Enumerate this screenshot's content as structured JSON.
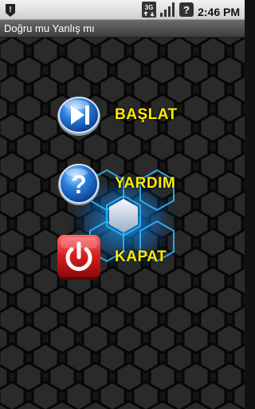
{
  "status_bar": {
    "network_type": "3G",
    "time": "2:46 PM",
    "icons": [
      "notification-icon",
      "network-3g-icon",
      "signal-icon",
      "battery-icon"
    ]
  },
  "app": {
    "title": "Doğru mu Yanlış mı"
  },
  "menu": {
    "items": [
      {
        "label": "BAŞLAT",
        "icon": "play-skip-icon"
      },
      {
        "label": "YARDIM",
        "icon": "help-icon"
      },
      {
        "label": "KAPAT",
        "icon": "power-icon"
      }
    ]
  },
  "colors": {
    "label_yellow": "#ffeb00",
    "glow_blue": "#19a8ff",
    "button_blue": "#2b7fe0",
    "button_red": "#d81c1c"
  }
}
